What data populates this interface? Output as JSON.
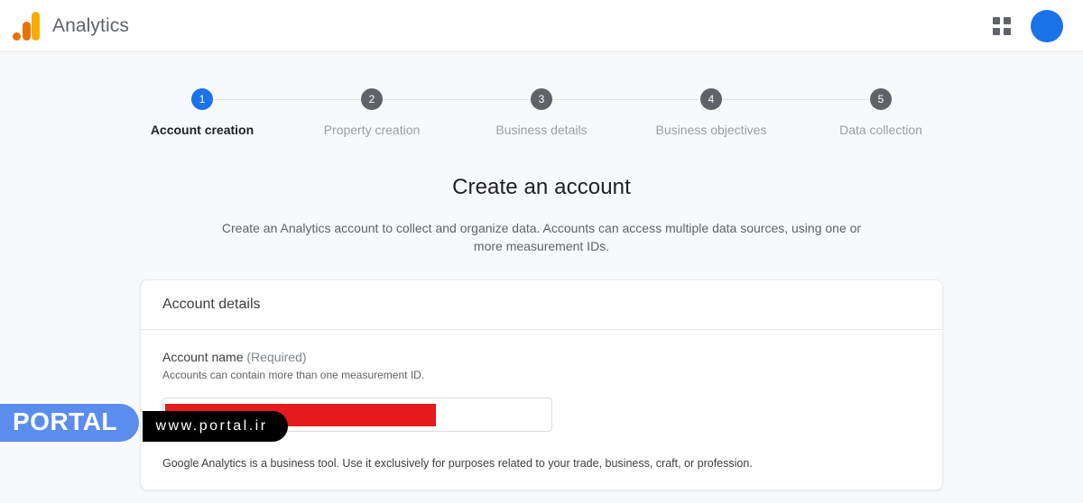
{
  "appbar": {
    "logo_icon": "google-analytics-logo-icon",
    "title": "Analytics",
    "apps_icon": "apps-grid-icon",
    "avatar_label": "",
    "colors": {
      "logo_yellow": "#f9ab00",
      "logo_orange": "#e8710a",
      "avatar_blue": "#1a73e8",
      "icon_gray": "#5f6368"
    }
  },
  "stepper": {
    "active_index": 0,
    "active_color": "#1a73e8",
    "inactive_color": "#5f6368",
    "steps": [
      {
        "number": "1",
        "label": "Account creation"
      },
      {
        "number": "2",
        "label": "Property creation"
      },
      {
        "number": "3",
        "label": "Business details"
      },
      {
        "number": "4",
        "label": "Business objectives"
      },
      {
        "number": "5",
        "label": "Data collection"
      }
    ]
  },
  "main": {
    "title": "Create an account",
    "subtitle": "Create an Analytics account to collect and organize data. Accounts can access multiple data sources, using one or more measurement IDs."
  },
  "card": {
    "header": "Account details",
    "field": {
      "label": "Account name",
      "required_suffix": "(Required)",
      "help": "Accounts can contain more than one measurement ID.",
      "value": "",
      "placeholder": "",
      "redacted": true,
      "redaction_color": "#e31b1b"
    },
    "footnote": "Google Analytics is a business tool. Use it exclusively for purposes related to your trade, business, craft, or profession."
  },
  "watermark": {
    "brand": "PORTAL",
    "url": "www.portal.ir",
    "brand_color": "#5b8def",
    "url_color": "#000000"
  }
}
